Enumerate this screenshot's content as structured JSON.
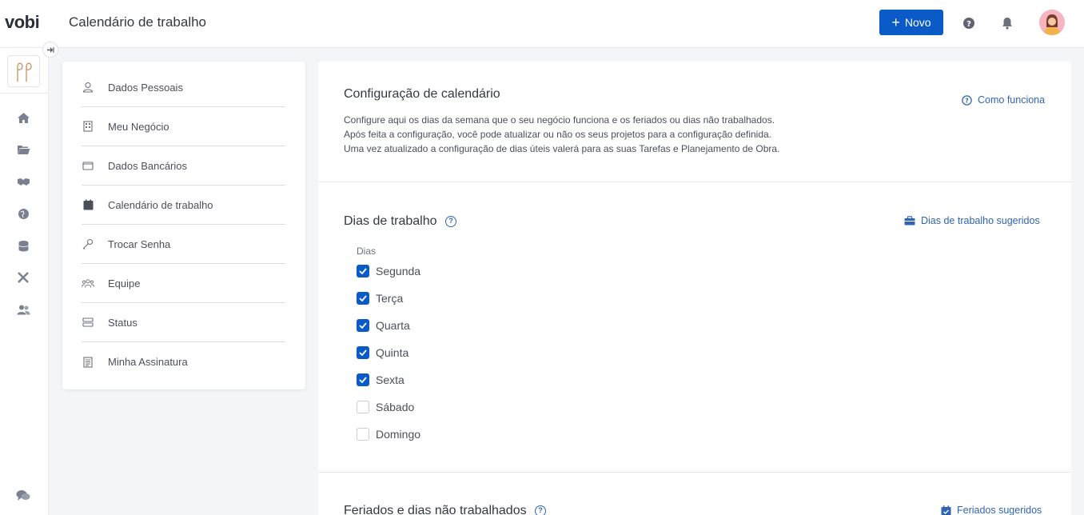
{
  "header": {
    "logo": "vobi",
    "title": "Calendário de trabalho",
    "new_button": "Novo",
    "new_plus": "+"
  },
  "colors": {
    "primary": "#0a5ac8",
    "link": "#2f64b5",
    "background": "#f4f5f9"
  },
  "rail": {
    "icons": [
      "home-icon",
      "folder-icon",
      "handshake-icon",
      "globe-icon",
      "coins-icon",
      "tools-icon",
      "users-icon",
      "chat-icon"
    ]
  },
  "menu": {
    "items": [
      {
        "label": "Dados Pessoais",
        "icon": "user-icon"
      },
      {
        "label": "Meu Negócio",
        "icon": "building-icon"
      },
      {
        "label": "Dados Bancários",
        "icon": "wallet-icon"
      },
      {
        "label": "Calendário de trabalho",
        "icon": "calendar-icon"
      },
      {
        "label": "Trocar Senha",
        "icon": "key-icon"
      },
      {
        "label": "Equipe",
        "icon": "team-icon"
      },
      {
        "label": "Status",
        "icon": "server-icon"
      },
      {
        "label": "Minha Assinatura",
        "icon": "receipt-icon"
      }
    ]
  },
  "config": {
    "title": "Configuração de calendário",
    "how_it_works": "Como funciona",
    "description": [
      "Configure aqui os dias da semana que o seu negócio funciona e os feriados ou dias não trabalhados.",
      "Após feita a configuração, você pode atualizar ou não os seus projetos para a configuração definida.",
      "Uma vez atualizado a configuração de dias úteis valerá para as suas Tarefas e Planejamento de Obra."
    ]
  },
  "workdays": {
    "title": "Dias de trabalho",
    "suggested_link": "Dias de trabalho sugeridos",
    "days_label": "Dias",
    "days": [
      {
        "label": "Segunda",
        "checked": true
      },
      {
        "label": "Terça",
        "checked": true
      },
      {
        "label": "Quarta",
        "checked": true
      },
      {
        "label": "Quinta",
        "checked": true
      },
      {
        "label": "Sexta",
        "checked": true
      },
      {
        "label": "Sábado",
        "checked": false
      },
      {
        "label": "Domingo",
        "checked": false
      }
    ]
  },
  "holidays": {
    "title": "Feriados e dias não trabalhados",
    "suggested_link": "Feriados sugeridos"
  }
}
